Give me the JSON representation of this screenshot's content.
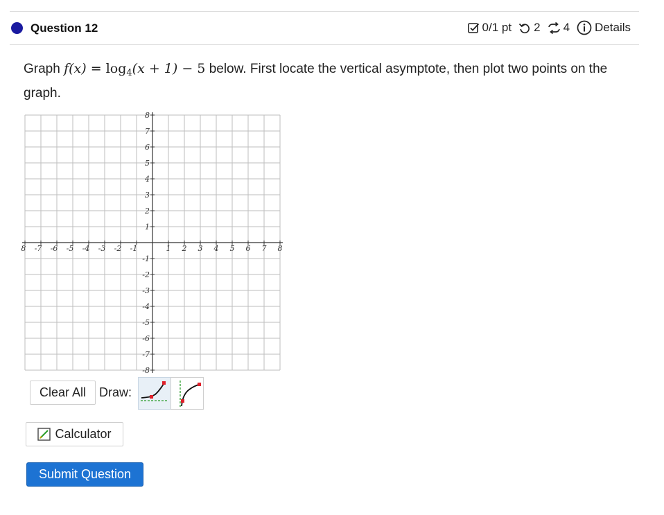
{
  "question": {
    "title": "Question 12",
    "score": "0/1 pt",
    "retries": "2",
    "attempts": "4",
    "details_label": "Details"
  },
  "prompt": {
    "before": "Graph",
    "formula": {
      "fx": "f(x)",
      "equals": "=",
      "log": "log",
      "base": "4",
      "arg": "(x + 1)",
      "minus": "− 5"
    },
    "after": "below. First locate the vertical asymptote, then plot two points on the graph."
  },
  "graph": {
    "x_min": -8,
    "x_max": 8,
    "y_min": -8,
    "y_max": 8,
    "x_tick_labels": [
      "-8",
      "-7",
      "-6",
      "-5",
      "-4",
      "-3",
      "-2",
      "-1",
      "1",
      "2",
      "3",
      "4",
      "5",
      "6",
      "7",
      "8"
    ],
    "y_tick_labels": [
      "8",
      "7",
      "6",
      "5",
      "4",
      "3",
      "2",
      "1",
      "-1",
      "-2",
      "-3",
      "-4",
      "-5",
      "-6",
      "-7",
      "-8"
    ],
    "grid_color": "#bdbdbd",
    "axis_color": "#333333"
  },
  "toolbar": {
    "clear_label": "Clear All",
    "draw_label": "Draw:",
    "tools": [
      "exponential-tool-icon",
      "logarithm-tool-icon"
    ],
    "selected_tool": "exponential-tool-icon"
  },
  "calculator_label": "Calculator",
  "submit_label": "Submit Question",
  "colors": {
    "accent": "#1d73d3",
    "indicator": "#1a1aa0",
    "tool_mark": "#e0202a",
    "asymptote": "#2a9d2a"
  }
}
